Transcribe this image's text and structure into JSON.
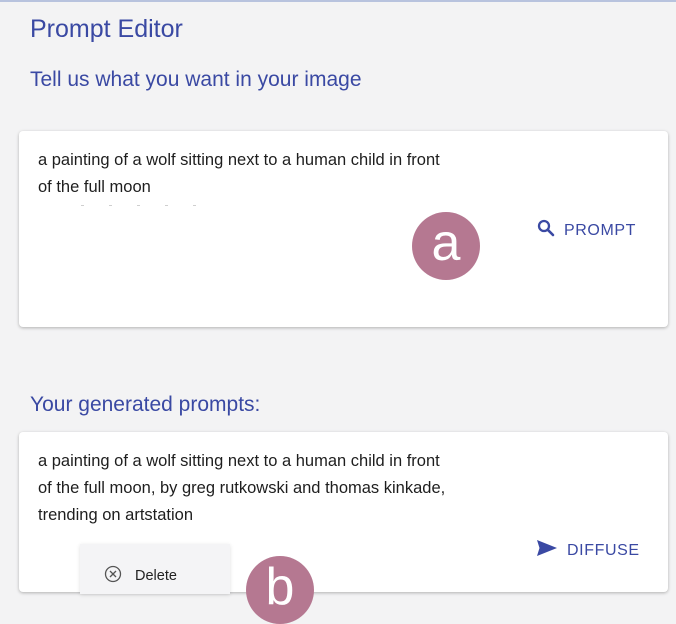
{
  "app": {
    "title": "Prompt Editor"
  },
  "input_section": {
    "label": "Tell us what you want in your image",
    "prompt_text": "a painting of a wolf sitting next to a human child in front\nof the full moon",
    "prompt_button": {
      "label": "PROMPT",
      "icon": "search-icon"
    },
    "marker": "a"
  },
  "output_section": {
    "heading": "Your generated prompts:",
    "generated_prompts": [
      {
        "text": "a painting of a wolf sitting next to a human child in front\nof the full moon, by greg rutkowski and thomas kinkade,\ntrending on artstation",
        "diffuse_button": {
          "label": "DIFFUSE",
          "icon": "send-icon"
        }
      }
    ],
    "context_menu": {
      "items": [
        {
          "label": "Delete",
          "icon": "cancel-circle-icon"
        }
      ]
    },
    "marker": "b"
  },
  "colors": {
    "accent": "#3a49a3",
    "marker": "#b57891",
    "background": "#f3f3f4"
  }
}
